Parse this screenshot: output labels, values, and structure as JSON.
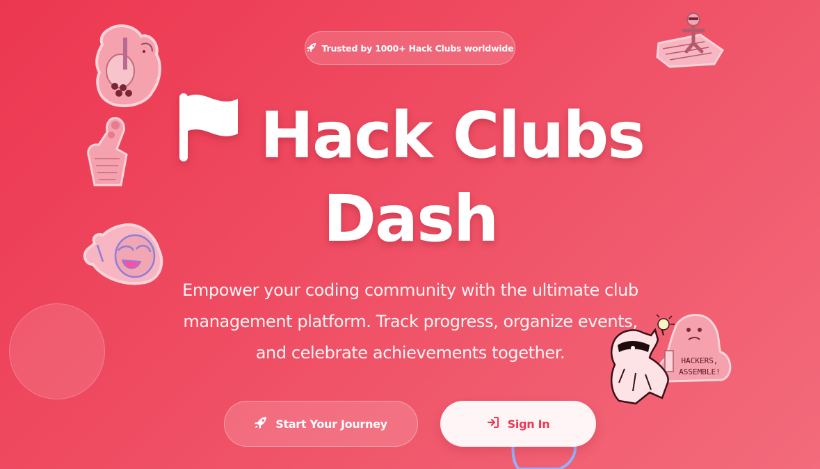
{
  "badge": {
    "icon": "rocket-icon",
    "text": "Trusted by 1000+ Hack Clubs worldwide"
  },
  "title": {
    "icon": "flag-icon",
    "line1": "Hack Clubs",
    "line2": "Dash"
  },
  "subtitle": {
    "line1": "Empower your coding community with the ultimate club",
    "line2": "management platform. Track progress, organize events,",
    "line3": "and celebrate achievements together."
  },
  "buttons": {
    "primary": {
      "label": "Start Your Journey",
      "icon": "rocket-icon"
    },
    "secondary": {
      "label": "Sign In",
      "icon": "sign-in-icon"
    }
  },
  "stickers": {
    "hackers_assemble_text": "HACKERS, ASSEMBLE!"
  },
  "colors": {
    "background": "#ec3750",
    "accent": "#ec3750",
    "text": "#ffffff"
  }
}
